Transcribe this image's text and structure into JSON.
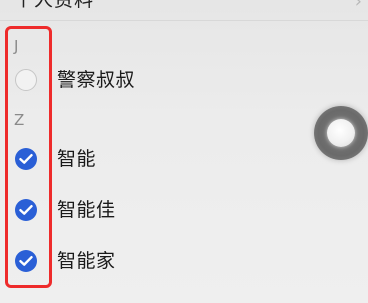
{
  "header": {
    "title": "个人资料",
    "chevron_icon": "chevron-right-icon"
  },
  "sections": [
    {
      "letter": "J",
      "contacts": [
        {
          "name": "警察叔叔",
          "checked": false
        }
      ]
    },
    {
      "letter": "Z",
      "contacts": [
        {
          "name": "智能",
          "checked": true
        },
        {
          "name": "智能佳",
          "checked": true
        },
        {
          "name": "智能家",
          "checked": true
        }
      ]
    }
  ],
  "colors": {
    "check_accent": "#2a5fd6",
    "highlight": "#ee2b2b",
    "background": "#e9e9e9"
  },
  "floating_button": {
    "icon": "assistive-touch-icon"
  }
}
